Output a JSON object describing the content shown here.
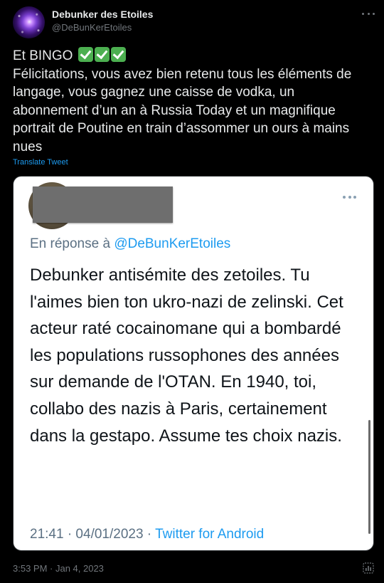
{
  "author": {
    "display_name": "Debunker des Etoiles",
    "handle": "@DeBunKerEtoiles",
    "avatar_icon": "galaxy-avatar"
  },
  "tweet": {
    "first_line": "Et BINGO",
    "emoji": [
      "white-check-mark",
      "white-check-mark",
      "white-check-mark"
    ],
    "body": "Félicitations, vous avez bien retenu tous les éléments de langage, vous gagnez une caisse de vodka, un abonnement d’un an à Russia Today et un magnifique portrait de Poutine en train d’assommer un ours à mains nues",
    "translate_label": "Translate Tweet"
  },
  "screenshot": {
    "reply_prefix": "En réponse à",
    "reply_handle": "@DeBunKerEtoiles",
    "text": "Debunker antisémite des zetoiles. Tu l'aimes bien ton ukro-nazi de zelinski. Cet acteur raté cocainomane qui a bombardé les populations russophones des années sur demande de l'OTAN. En 1940, toi, collabo des nazis à Paris, certainement dans la gestapo. Assume tes choix nazis.",
    "time_date": "21:41 · 04/01/2023",
    "separator": " · ",
    "source": "Twitter for Android"
  },
  "footer": {
    "timestamp": "3:53 PM · Jan 4, 2023"
  },
  "colors": {
    "background": "#000000",
    "accent": "#1d9bf0",
    "check_green": "#4caf50"
  }
}
